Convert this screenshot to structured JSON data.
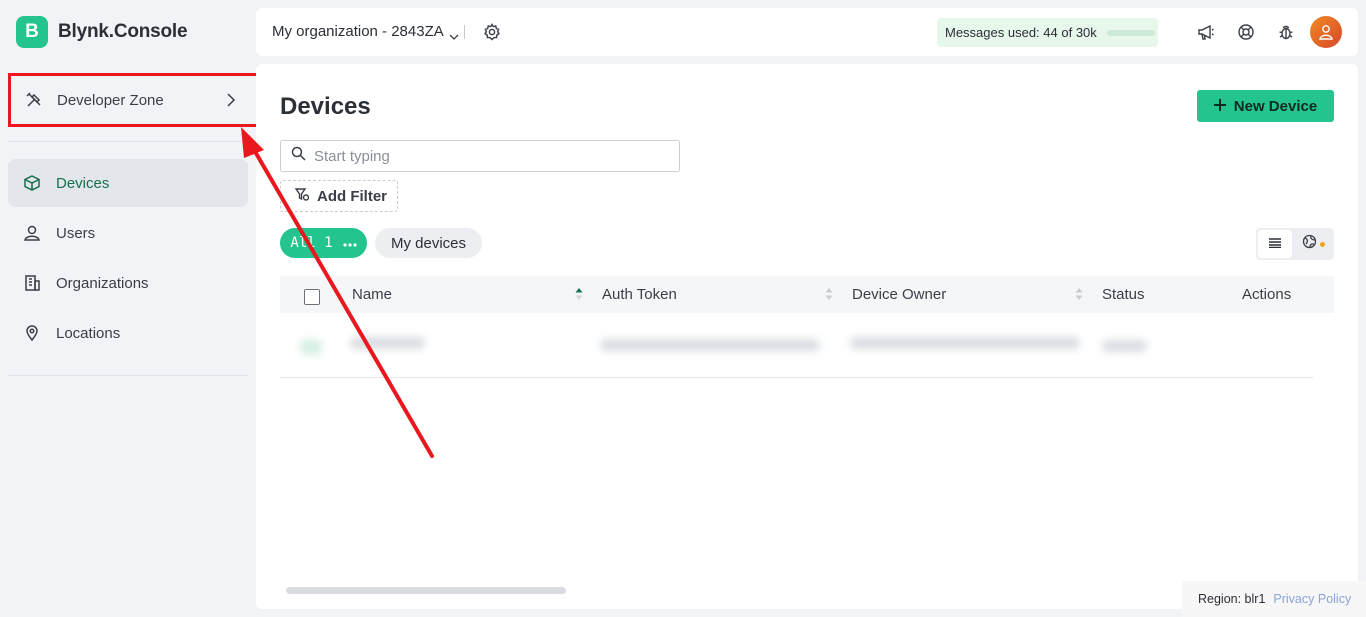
{
  "brand": {
    "letter": "B",
    "name": "Blynk.Console"
  },
  "sidebar": {
    "developer_zone": "Developer Zone",
    "items": [
      {
        "label": "Devices",
        "icon": "cube-icon",
        "active": true
      },
      {
        "label": "Users",
        "icon": "users-icon",
        "active": false
      },
      {
        "label": "Organizations",
        "icon": "building-icon",
        "active": false
      },
      {
        "label": "Locations",
        "icon": "location-pin-icon",
        "active": false
      }
    ]
  },
  "header": {
    "organization": "My organization - 2843ZA",
    "messages_label": "Messages used:",
    "messages_value": "44 of 30k",
    "messages_used_fraction": 0.0015
  },
  "main": {
    "title": "Devices",
    "new_device_label": "New Device",
    "search_placeholder": "Start typing",
    "add_filter_label": "Add Filter",
    "chips": {
      "all_label": "All 1",
      "my_devices_label": "My devices"
    },
    "table": {
      "columns": [
        "Name",
        "Auth Token",
        "Device Owner",
        "Status",
        "Actions"
      ]
    }
  },
  "footer": {
    "region": "Region: blr1",
    "privacy": "Privacy Policy"
  },
  "colors": {
    "accent": "#23c48e",
    "annotation": "#e8181e"
  }
}
